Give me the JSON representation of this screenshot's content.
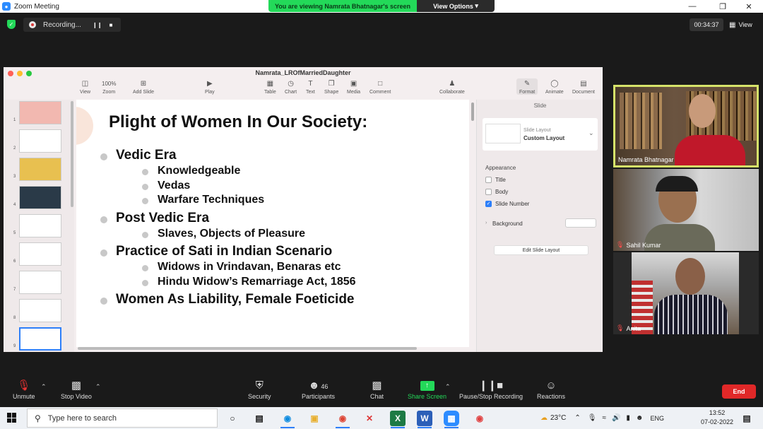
{
  "window": {
    "title": "Zoom Meeting"
  },
  "banner": {
    "text": "You are viewing Namrata Bhatnagar's screen",
    "options_label": "View Options"
  },
  "recording": {
    "label": "Recording..."
  },
  "meeting": {
    "timer": "00:34:37",
    "view_label": "View"
  },
  "keynote": {
    "title": "Namrata_LROfMarriedDaughter",
    "toolbar": {
      "view": "View",
      "zoom_value": "100%",
      "zoom": "Zoom",
      "add_slide": "Add Slide",
      "play": "Play",
      "table": "Table",
      "chart": "Chart",
      "text": "Text",
      "shape": "Shape",
      "media": "Media",
      "comment": "Comment",
      "collaborate": "Collaborate",
      "format": "Format",
      "animate": "Animate",
      "document": "Document"
    },
    "thumb_numbers": [
      "1",
      "2",
      "3",
      "4",
      "5",
      "6",
      "7",
      "8",
      "9"
    ],
    "slide": {
      "title": "Plight of Women In Our Society:",
      "items": [
        {
          "text": "Vedic Era",
          "sub": [
            "Knowledgeable",
            "Vedas",
            "Warfare Techniques"
          ]
        },
        {
          "text": "Post Vedic Era",
          "sub": [
            "Slaves, Objects of Pleasure"
          ]
        },
        {
          "text": "Practice of Sati in Indian Scenario",
          "sub": [
            "Widows in Vrindavan, Benaras etc",
            "Hindu Widow’s Remarriage Act, 1856"
          ]
        },
        {
          "text": "Women As Liability, Female Foeticide",
          "sub": []
        }
      ]
    },
    "inspector": {
      "tab": "Slide",
      "layout_caption": "Slide Layout",
      "layout_value": "Custom Layout",
      "appearance": "Appearance",
      "options": [
        {
          "label": "Title",
          "checked": false
        },
        {
          "label": "Body",
          "checked": false
        },
        {
          "label": "Slide Number",
          "checked": true
        }
      ],
      "background": "Background",
      "edit_layout": "Edit Slide Layout"
    }
  },
  "participants": [
    {
      "name": "Namrata Bhatnagar",
      "muted": false
    },
    {
      "name": "Sahil Kumar",
      "muted": true
    },
    {
      "name": "Anita",
      "muted": true
    }
  ],
  "toolbar": {
    "unmute": "Unmute",
    "stop_video": "Stop Video",
    "security": "Security",
    "participants": "Participants",
    "participant_count": "46",
    "chat": "Chat",
    "share_screen": "Share Screen",
    "pause_recording": "Pause/Stop Recording",
    "reactions": "Reactions",
    "end": "End"
  },
  "taskbar": {
    "search_placeholder": "Type here to search",
    "temperature": "23°C",
    "language": "ENG",
    "time": "13:52",
    "date": "07-02-2022"
  },
  "colors": {
    "zoom_blue": "#2D8CFF",
    "banner_green": "#23d959",
    "end_red": "#e02828",
    "active_border": "#d6e36a"
  }
}
